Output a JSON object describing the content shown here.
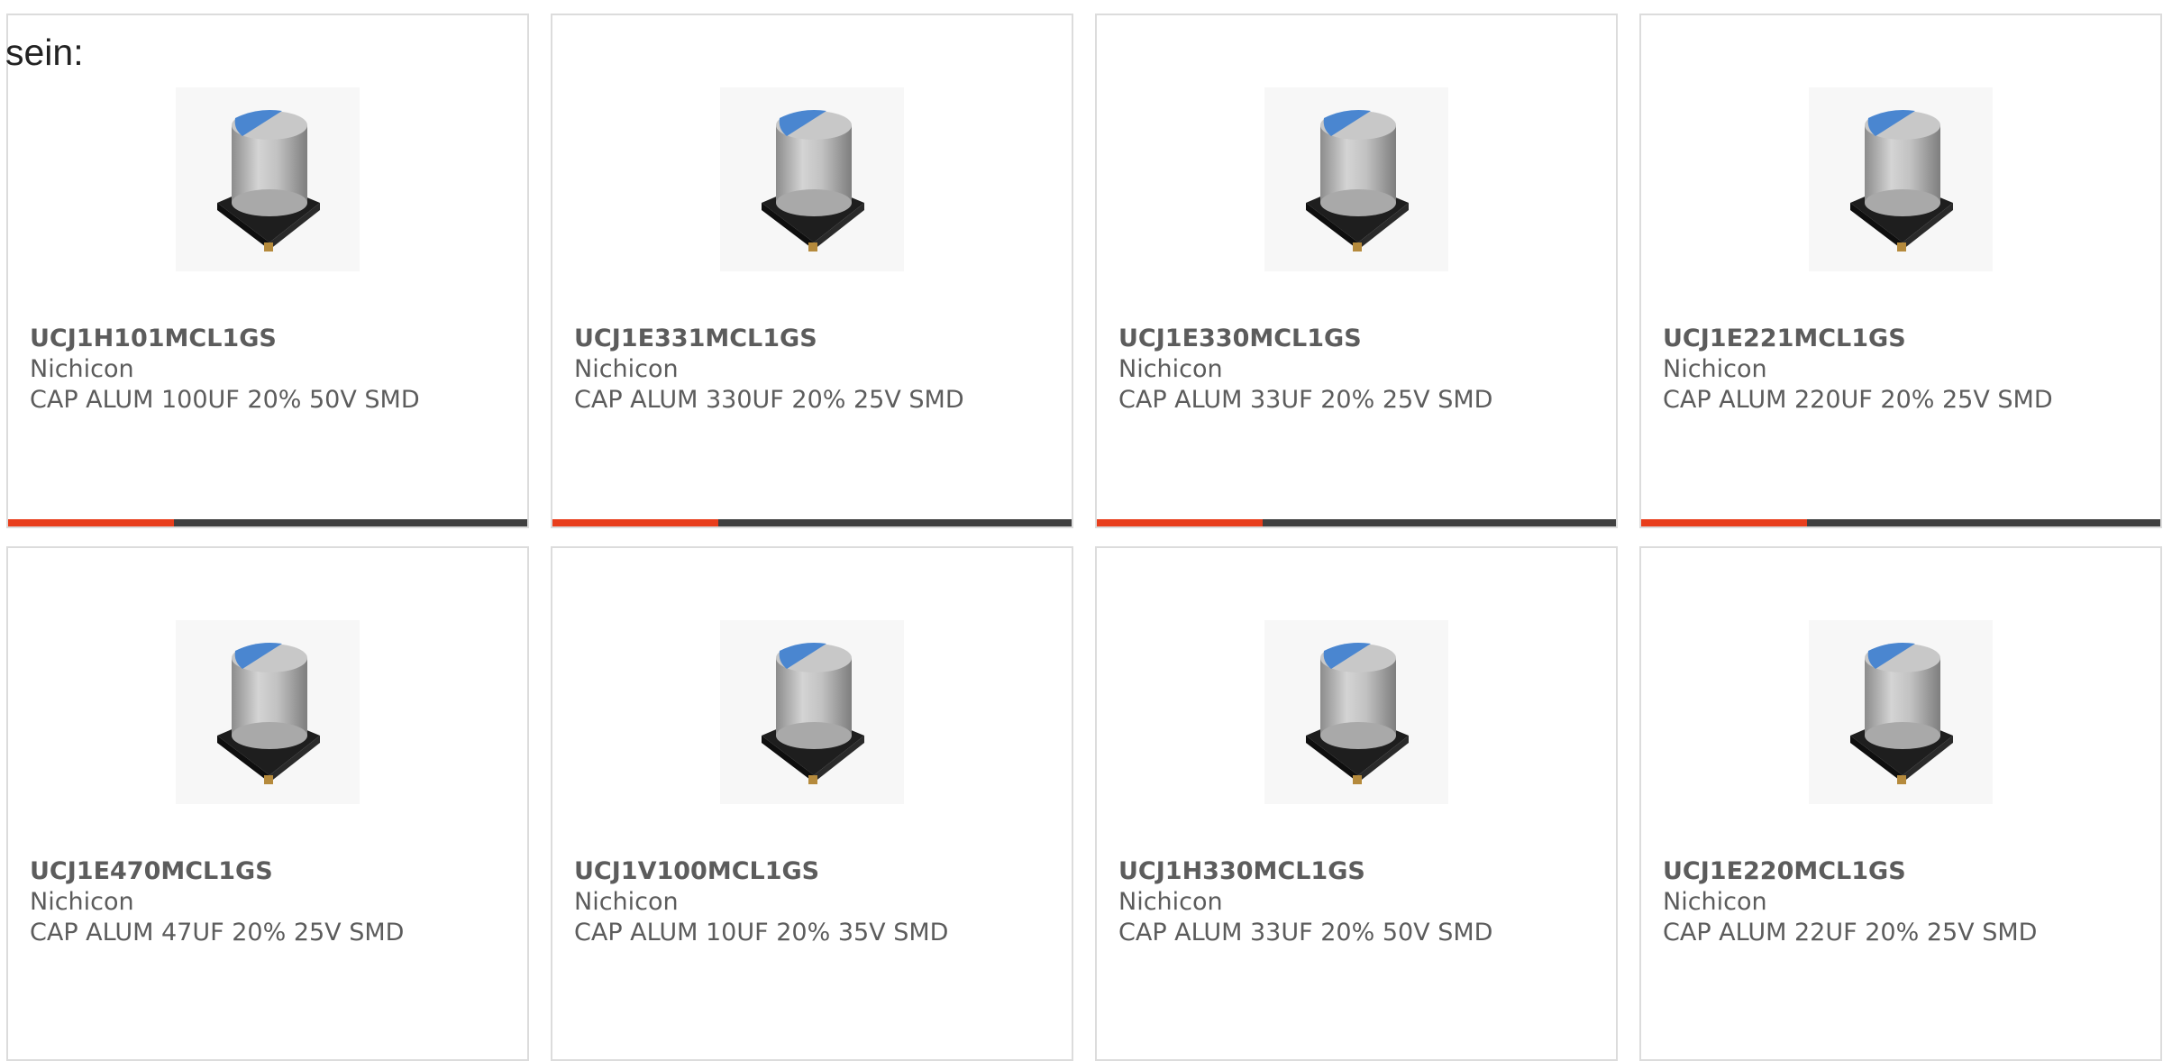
{
  "intro_text": "sein:",
  "colors": {
    "accent": "#e83e1c",
    "bar_track": "#404040",
    "card_border": "#dcdcdc",
    "cap_top": "#4a86d0"
  },
  "products": [
    {
      "part": "UCJ1H101MCL1GS",
      "maker": "Nichicon",
      "desc": "CAP ALUM 100UF 20% 50V SMD",
      "image": "capacitor-image",
      "progress": 0.32
    },
    {
      "part": "UCJ1E331MCL1GS",
      "maker": "Nichicon",
      "desc": "CAP ALUM 330UF 20% 25V SMD",
      "image": "capacitor-image",
      "progress": 0.32
    },
    {
      "part": "UCJ1E330MCL1GS",
      "maker": "Nichicon",
      "desc": "CAP ALUM 33UF 20% 25V SMD",
      "image": "capacitor-image",
      "progress": 0.32
    },
    {
      "part": "UCJ1E221MCL1GS",
      "maker": "Nichicon",
      "desc": "CAP ALUM 220UF 20% 25V SMD",
      "image": "capacitor-image",
      "progress": 0.32
    },
    {
      "part": "UCJ1E470MCL1GS",
      "maker": "Nichicon",
      "desc": "CAP ALUM 47UF 20% 25V SMD",
      "image": "capacitor-image"
    },
    {
      "part": "UCJ1V100MCL1GS",
      "maker": "Nichicon",
      "desc": "CAP ALUM 10UF 20% 35V SMD",
      "image": "capacitor-image"
    },
    {
      "part": "UCJ1H330MCL1GS",
      "maker": "Nichicon",
      "desc": "CAP ALUM 33UF 20% 50V SMD",
      "image": "capacitor-image"
    },
    {
      "part": "UCJ1E220MCL1GS",
      "maker": "Nichicon",
      "desc": "CAP ALUM 22UF 20% 25V SMD",
      "image": "capacitor-image"
    }
  ]
}
